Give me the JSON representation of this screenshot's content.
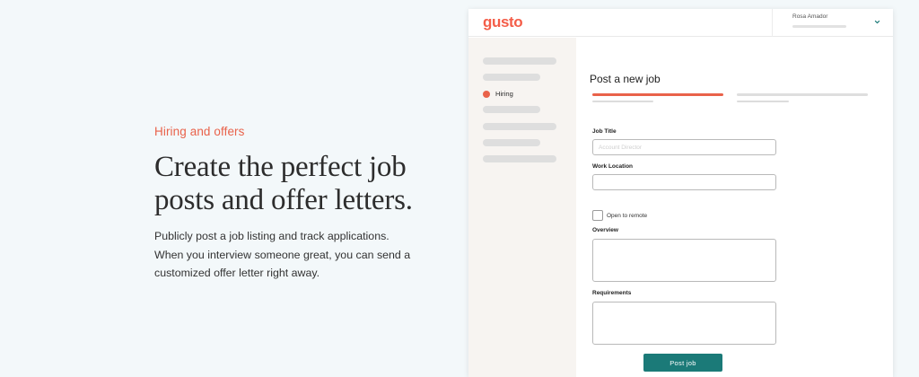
{
  "hero": {
    "eyebrow": "Hiring and offers",
    "headline_line1": "Create the perfect job",
    "headline_line2": "posts and offer letters.",
    "body_line1": "Publicly post a job listing and track applications.",
    "body_line2": "When you interview someone great, you can send a",
    "body_line3": "customized offer letter right away."
  },
  "app": {
    "logo": "gusto",
    "user_name": "Rosa Amador",
    "nav_active_label": "Hiring",
    "page_title": "Post a new job",
    "form": {
      "job_title_label": "Job Title",
      "job_title_placeholder": "Account Director",
      "work_location_label": "Work Location",
      "work_location_value": "",
      "remote_label": "Open to remote",
      "overview_label": "Overview",
      "requirements_label": "Requirements",
      "submit_label": "Post  job"
    }
  },
  "colors": {
    "accent": "#e9624a",
    "brand": "#f45d48",
    "button": "#1b7a78",
    "background": "#f3f8fa"
  }
}
